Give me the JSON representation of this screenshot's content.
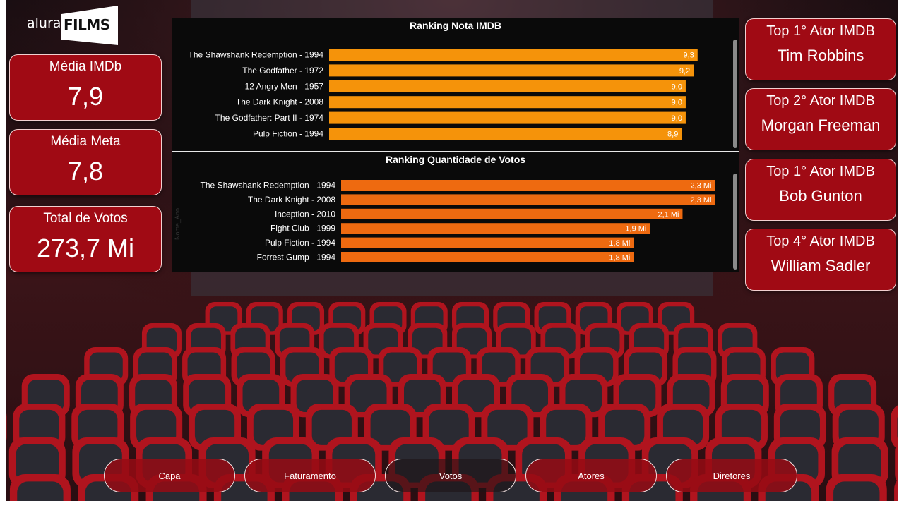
{
  "brand": {
    "prefix": "alura",
    "name": "FILMS"
  },
  "kpis": [
    {
      "label": "Média IMDb",
      "value": "7,9"
    },
    {
      "label": "Média Meta",
      "value": "7,8"
    },
    {
      "label": "Total de Votos",
      "value": "273,7 Mi"
    }
  ],
  "actors": [
    {
      "label": "Top 1° Ator IMDB",
      "name": "Tim Robbins"
    },
    {
      "label": "Top 2° Ator IMDB",
      "name": "Morgan Freeman"
    },
    {
      "label": "Top 1° Ator IMDB",
      "name": "Bob Gunton"
    },
    {
      "label": "Top 4° Ator IMDB",
      "name": "William Sadler"
    }
  ],
  "nav": [
    {
      "label": "Capa",
      "active": false
    },
    {
      "label": "Faturamento",
      "active": false
    },
    {
      "label": "Votos",
      "active": true
    },
    {
      "label": "Atores",
      "active": false
    },
    {
      "label": "Diretores",
      "active": false
    }
  ],
  "colors": {
    "imdb_bar": "#f5930a",
    "votes_bar": "#ee6a10",
    "card": "#a00a14"
  },
  "chart_data": [
    {
      "type": "bar",
      "orientation": "horizontal",
      "title": "Ranking Nota IMDB",
      "categories": [
        "The Shawshank Redemption - 1994",
        "The Godfather - 1972",
        "12 Angry Men - 1957",
        "The Dark Knight - 2008",
        "The Godfather: Part II - 1974",
        "Pulp Fiction - 1994"
      ],
      "values": [
        9.3,
        9.2,
        9.0,
        9.0,
        9.0,
        8.9
      ],
      "labels": [
        "9,3",
        "9,2",
        "9,0",
        "9,0",
        "9,0",
        "8,9"
      ],
      "xlim": [
        0,
        9.5
      ],
      "grid": false
    },
    {
      "type": "bar",
      "orientation": "horizontal",
      "title": "Ranking Quantidade de Votos",
      "ylabel": "Nome_Ano",
      "categories": [
        "The Shawshank Redemption - 1994",
        "The Dark Knight - 2008",
        "Inception - 2010",
        "Fight Club - 1999",
        "Pulp Fiction - 1994",
        "Forrest Gump - 1994"
      ],
      "values": [
        2.3,
        2.3,
        2.1,
        1.9,
        1.8,
        1.8
      ],
      "labels": [
        "2,3 Mi",
        "2,3 Mi",
        "2,1 Mi",
        "1,9 Mi",
        "1,8 Mi",
        "1,8 Mi"
      ],
      "xlim": [
        0,
        2.35
      ],
      "grid": false
    }
  ]
}
